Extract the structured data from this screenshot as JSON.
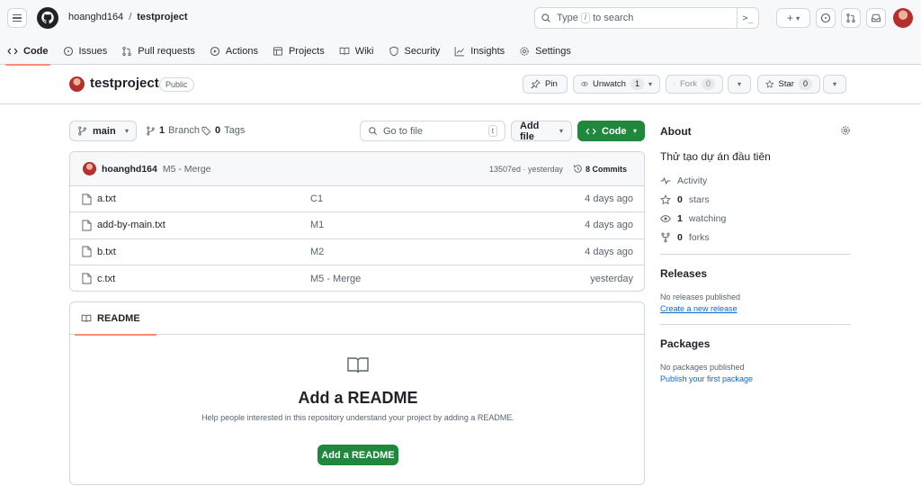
{
  "header": {
    "owner": "hoanghd164",
    "separator": "/",
    "repo": "testproject",
    "search": {
      "prefix": "Type",
      "key": "/",
      "suffix": "to search"
    },
    "command_palette": ">_"
  },
  "tabs": [
    {
      "label": "Code",
      "icon": "code-icon",
      "selected": true
    },
    {
      "label": "Issues",
      "icon": "issue-icon"
    },
    {
      "label": "Pull requests",
      "icon": "pull-request-icon"
    },
    {
      "label": "Actions",
      "icon": "play-icon"
    },
    {
      "label": "Projects",
      "icon": "table-icon"
    },
    {
      "label": "Wiki",
      "icon": "book-icon"
    },
    {
      "label": "Security",
      "icon": "shield-icon"
    },
    {
      "label": "Insights",
      "icon": "graph-icon"
    },
    {
      "label": "Settings",
      "icon": "gear-icon"
    }
  ],
  "repo_header": {
    "name": "testproject",
    "visibility": "Public",
    "pin_label": "Pin",
    "unwatch_label": "Unwatch",
    "unwatch_count": "1",
    "fork_label": "Fork",
    "fork_count": "0",
    "star_label": "Star",
    "star_count": "0"
  },
  "file_nav": {
    "branch": "main",
    "branch_count": "1",
    "branch_label": "Branch",
    "tag_count": "0",
    "tag_label": "Tags",
    "goto_placeholder": "Go to file",
    "goto_key": "t",
    "add_file": "Add file",
    "code_button": "Code"
  },
  "latest_commit": {
    "user": "hoanghd164",
    "message": "M5 - Merge",
    "sha_time": "13507ed · yesterday",
    "commits": "8 Commits"
  },
  "files": [
    {
      "name": "a.txt",
      "message": "C1",
      "date": "4 days ago"
    },
    {
      "name": "add-by-main.txt",
      "message": "M1",
      "date": "4 days ago"
    },
    {
      "name": "b.txt",
      "message": "M2",
      "date": "4 days ago"
    },
    {
      "name": "c.txt",
      "message": "M5 - Merge",
      "date": "yesterday"
    }
  ],
  "readme": {
    "tab": "README",
    "title": "Add a README",
    "help": "Help people interested in this repository understand your project by adding a README.",
    "button": "Add a README"
  },
  "sidebar": {
    "about_title": "About",
    "description": "Thử tạo dự án đầu tiên",
    "activity": "Activity",
    "stars_count": "0",
    "stars_label": "stars",
    "watching_count": "1",
    "watching_label": "watching",
    "forks_count": "0",
    "forks_label": "forks",
    "releases_title": "Releases",
    "releases_note": "No releases published",
    "releases_link": "Create a new release",
    "packages_title": "Packages",
    "packages_note": "No packages published",
    "packages_link": "Publish your first package"
  },
  "colors": {
    "primary_green": "#1f883d",
    "tab_underline": "#fd8c73",
    "link_blue": "#0969da",
    "border": "#d0d7de"
  }
}
